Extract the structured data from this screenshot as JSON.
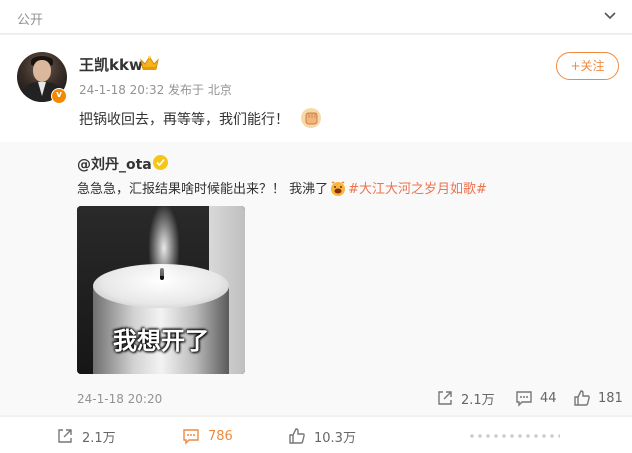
{
  "header": {
    "visibility": "公开",
    "icons": {
      "collapse": "chevron-down-icon"
    }
  },
  "post": {
    "author": "王凯kkw",
    "author_badge": "crown-icon",
    "verified_badge": "v",
    "meta": "24-1-18 20:32 发布于 北京",
    "follow_label": "+关注",
    "text": "把锅收回去，再等等，我们能行！",
    "text_emoji": "fist-emoji",
    "accent_color": "#f08a3d"
  },
  "repost": {
    "author": "@刘丹_ota",
    "text_before": "急急急，汇报结果啥时候能出来？！ 我沸了",
    "text_emoji": "boiling-emoji",
    "hashtag": "#大江大河之岁月如歌#",
    "image_caption": "我想开了",
    "date": "24-1-18 20:20",
    "reposts": "2.1万",
    "comments": "44",
    "likes": "181"
  },
  "actions": {
    "reposts": "2.1万",
    "comments": "786",
    "likes": "10.3万"
  }
}
